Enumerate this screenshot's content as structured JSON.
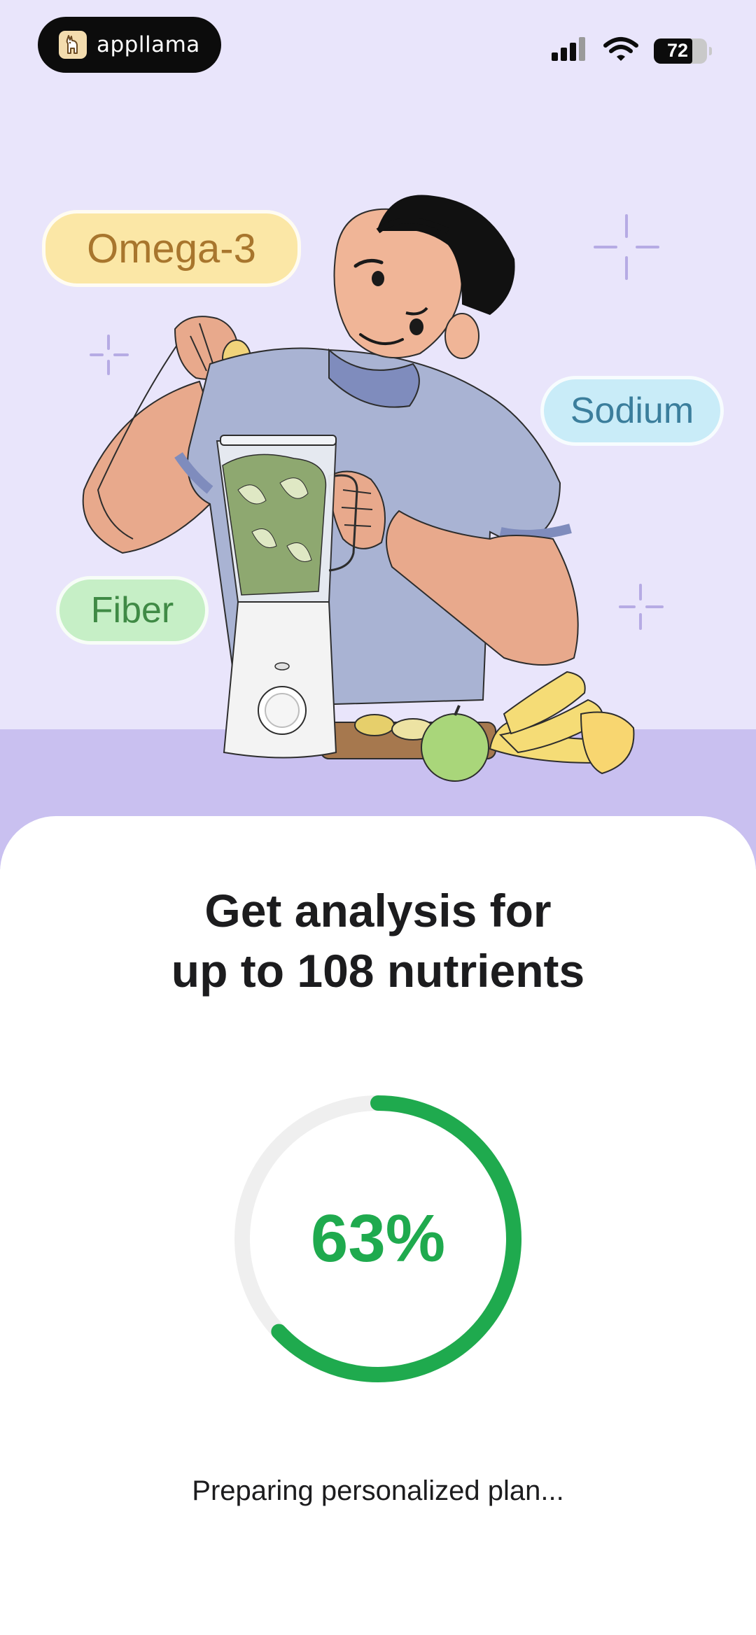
{
  "status_bar": {
    "brand": "appllama",
    "battery": "72",
    "battery_level": 0.72,
    "icons": [
      "signal-icon",
      "wifi-icon",
      "battery-icon"
    ]
  },
  "tags": {
    "omega": "Omega-3",
    "sodium": "Sodium",
    "fiber": "Fiber"
  },
  "main": {
    "title_line1": "Get analysis for",
    "title_line2": "up to 108 nutrients",
    "progress_label": "63%",
    "progress_value": 0.63,
    "status": "Preparing personalized plan..."
  },
  "colors": {
    "hero_bg": "#e9e5fb",
    "counter_bg": "#c9c0f0",
    "accent_green": "#1faa4e",
    "track_gray": "#efefef"
  }
}
